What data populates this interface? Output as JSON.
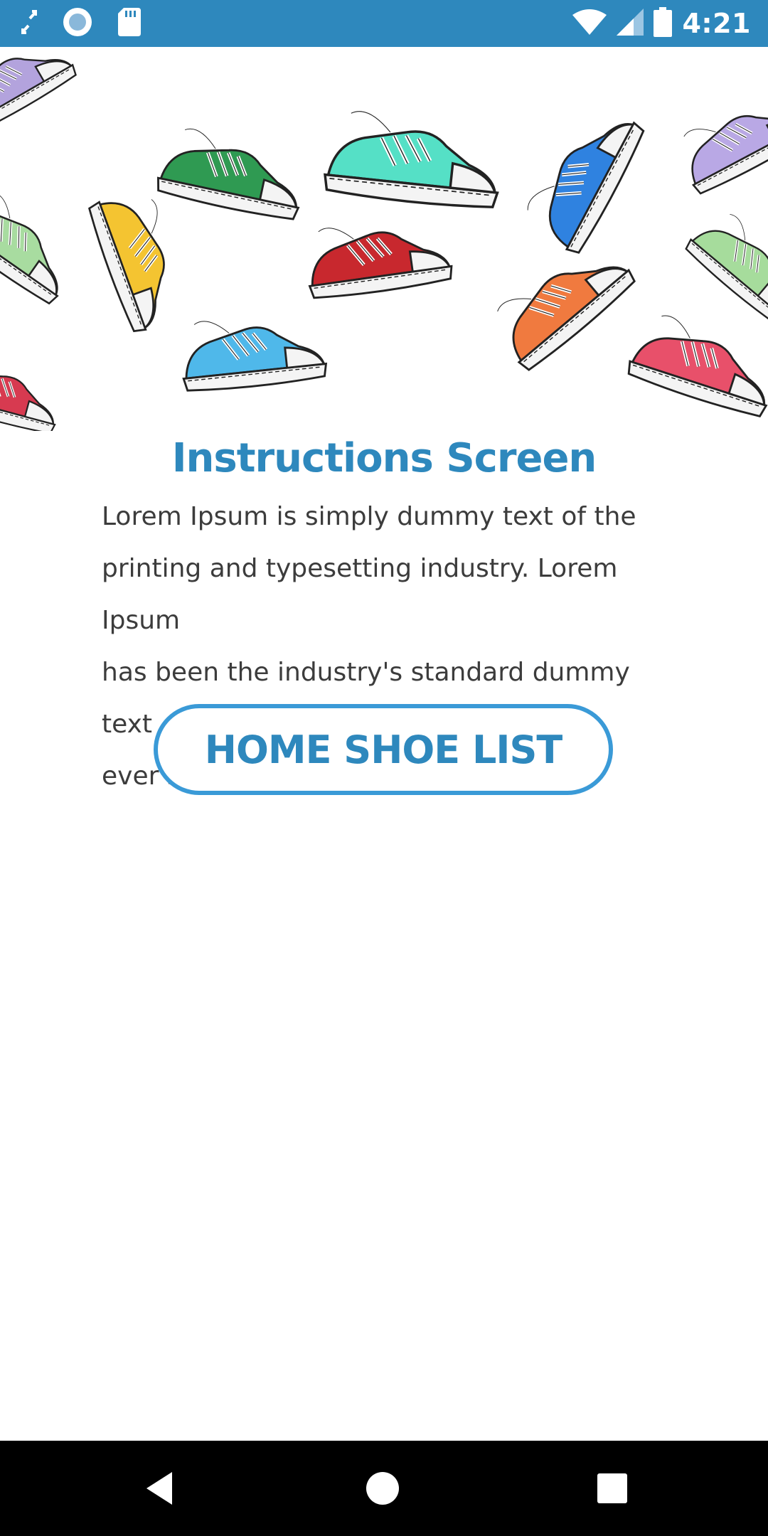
{
  "status_bar": {
    "time": "4:21",
    "icons": [
      "sync-icon",
      "circle-app-icon",
      "sd-card-icon",
      "wifi-icon",
      "signal-icon",
      "battery-icon"
    ],
    "color": "#2e88bd"
  },
  "hero": {
    "description_icons": [
      "sneaker-purple",
      "sneaker-green",
      "sneaker-teal",
      "sneaker-blue",
      "sneaker-lilac",
      "sneaker-yellow",
      "sneaker-red",
      "sneaker-lightgreen",
      "sneaker-orange",
      "sneaker-pink",
      "sneaker-skyblue",
      "sneaker-crimson"
    ]
  },
  "main": {
    "title": "Instructions Screen",
    "body_lines": [
      "Lorem Ipsum is simply dummy text of the",
      "printing and typesetting industry. Lorem Ipsum",
      "has been the industry's standard dummy text",
      "ever since the 1500s"
    ],
    "button_label": "HOME SHOE LIST",
    "accent_color": "#2e88bd"
  },
  "nav_bar": {
    "icons": [
      "back-icon",
      "home-icon",
      "recents-icon"
    ]
  }
}
